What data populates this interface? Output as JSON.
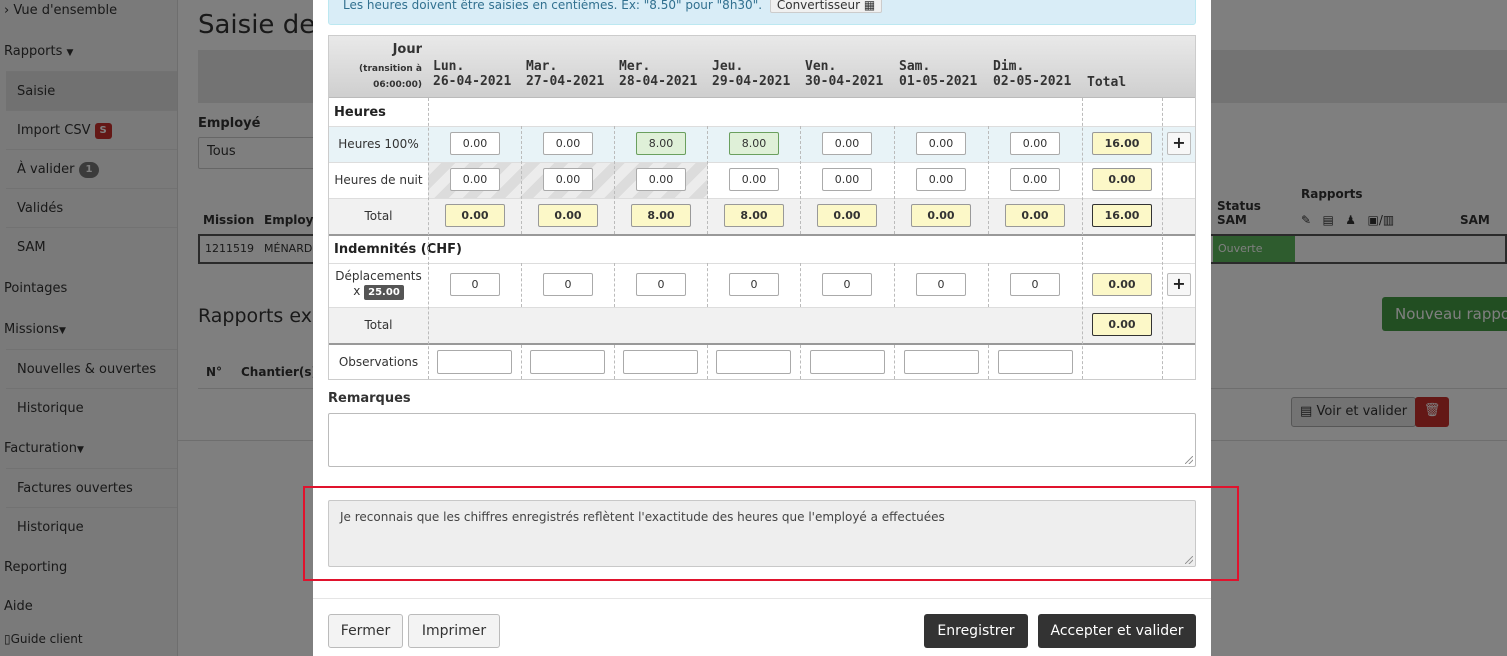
{
  "sidebar": {
    "overview": "Vue d'ensemble",
    "rapports": "Rapports",
    "rapports_items": [
      {
        "label": "Saisie"
      },
      {
        "label": "Import CSV",
        "badge": "S"
      },
      {
        "label": "À valider",
        "badge": "1"
      },
      {
        "label": "Validés"
      },
      {
        "label": "SAM"
      }
    ],
    "pointages": "Pointages",
    "missions": "Missions",
    "missions_items": [
      "Nouvelles & ouvertes",
      "Historique"
    ],
    "facturation": "Facturation",
    "facturation_items": [
      "Factures ouvertes",
      "Historique"
    ],
    "reporting": "Reporting",
    "aide": "Aide",
    "guide": "Guide client"
  },
  "background": {
    "title": "Saisie des",
    "employe_label": "Employé",
    "employe_value": "Tous",
    "table_headers": {
      "mission": "Mission",
      "employe": "Employé",
      "status_sam": "Status SAM",
      "rapports": "Rapports",
      "sam": "SAM"
    },
    "mission_row": {
      "id": "1211519",
      "name": "MÉNARD",
      "status": "Ouverte"
    },
    "rapports_existants": "Rapports exis",
    "list_headers": {
      "no": "N°",
      "chantier": "Chantier(s)"
    },
    "new_report_button": "Nouveau rapport",
    "voir_valider_button": "Voir et valider"
  },
  "modal": {
    "info": "Les heures doivent être saisies en centièmes. Ex: \"8.50\" pour \"8h30\".",
    "converter_button": "Convertisseur",
    "grid": {
      "jour_label": "Jour",
      "transition_label": "(transition à 06:00:00)",
      "days": [
        {
          "name": "Lun.",
          "date": "26-04-2021"
        },
        {
          "name": "Mar.",
          "date": "27-04-2021"
        },
        {
          "name": "Mer.",
          "date": "28-04-2021"
        },
        {
          "name": "Jeu.",
          "date": "29-04-2021"
        },
        {
          "name": "Ven.",
          "date": "30-04-2021"
        },
        {
          "name": "Sam.",
          "date": "01-05-2021"
        },
        {
          "name": "Dim.",
          "date": "02-05-2021"
        }
      ],
      "total_label": "Total",
      "heures_section": "Heures",
      "heures_100": {
        "label": "Heures 100%",
        "values": [
          "0.00",
          "0.00",
          "8.00",
          "8.00",
          "0.00",
          "0.00",
          "0.00"
        ],
        "total": "16.00"
      },
      "heures_nuit": {
        "label": "Heures de nuit",
        "values": [
          "0.00",
          "0.00",
          "0.00",
          "0.00",
          "0.00",
          "0.00",
          "0.00"
        ],
        "total": "0.00"
      },
      "heures_total": {
        "label": "Total",
        "values": [
          "0.00",
          "0.00",
          "8.00",
          "8.00",
          "0.00",
          "0.00",
          "0.00"
        ],
        "total": "16.00"
      },
      "indemnites_section": "Indemnités (CHF)",
      "deplacements": {
        "label": "Déplacements",
        "multiplier_prefix": "x",
        "multiplier": "25.00",
        "values": [
          "0",
          "0",
          "0",
          "0",
          "0",
          "0",
          "0"
        ],
        "total": "0.00"
      },
      "indemnites_total": {
        "label": "Total",
        "total": "0.00"
      },
      "observations_label": "Observations"
    },
    "remarques_label": "Remarques",
    "confirmation_text": "Je reconnais que les chiffres enregistrés reflètent l'exactitude des heures que l'employé a effectuées",
    "buttons": {
      "close": "Fermer",
      "print": "Imprimer",
      "save": "Enregistrer",
      "accept": "Accepter et valider"
    }
  }
}
